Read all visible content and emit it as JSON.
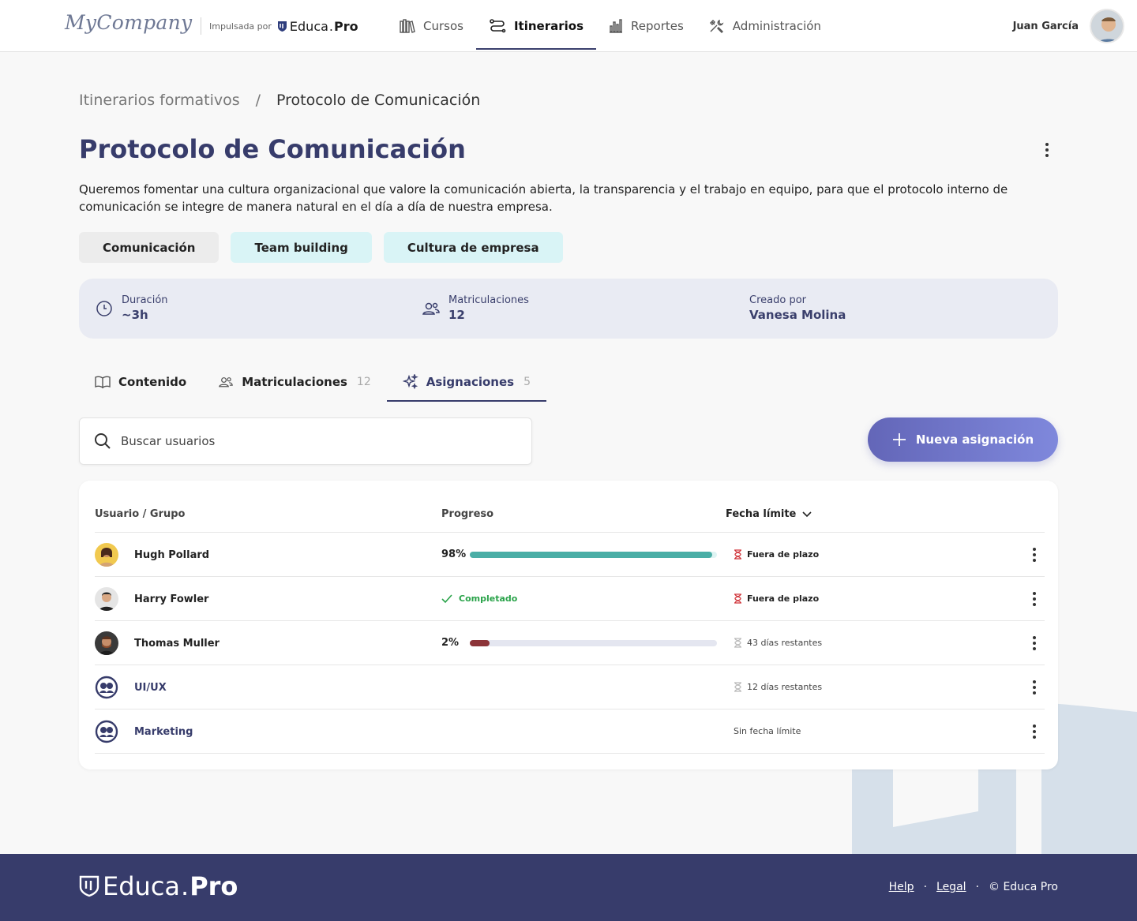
{
  "header": {
    "brand": "MyCompany",
    "powered_by": "Impulsada por",
    "educa_logo_text": "Educa",
    "educa_logo_bold": "Pro",
    "nav": [
      {
        "label": "Cursos",
        "icon": "books-icon",
        "active": false
      },
      {
        "label": "Itinerarios",
        "icon": "route-icon",
        "active": true
      },
      {
        "label": "Reportes",
        "icon": "bar-chart-icon",
        "active": false
      },
      {
        "label": "Administración",
        "icon": "tools-icon",
        "active": false
      }
    ],
    "user_name": "Juan García"
  },
  "breadcrumb": {
    "parent": "Itinerarios formativos",
    "separator": "/",
    "current": "Protocolo de Comunicación"
  },
  "page": {
    "title": "Protocolo de Comunicación",
    "description": "Queremos fomentar una cultura organizacional que valore la comunicación abierta, la transparencia y el trabajo en equipo, para que el protocolo interno de comunicación se integre de manera natural en el día a día de nuestra empresa.",
    "tags": [
      "Comunicación",
      "Team building",
      "Cultura de empresa"
    ]
  },
  "stats": {
    "duration_label": "Duración",
    "duration_value": "~3h",
    "enrollments_label": "Matriculaciones",
    "enrollments_value": "12",
    "created_label": "Creado por",
    "created_value": "Vanesa Molina"
  },
  "tabs": [
    {
      "label": "Contenido",
      "count": "",
      "icon": "book-icon"
    },
    {
      "label": "Matriculaciones",
      "count": "12",
      "icon": "users-icon"
    },
    {
      "label": "Asignaciones",
      "count": "5",
      "icon": "sparkles-icon",
      "active": true
    }
  ],
  "search": {
    "placeholder": "Buscar usuarios"
  },
  "new_button": {
    "label": "Nueva asignación"
  },
  "table": {
    "col_user": "Usuario / Grupo",
    "col_progress": "Progreso",
    "col_deadline": "Fecha límite",
    "rows": [
      {
        "name": "Hugh Pollard",
        "type": "user",
        "progress_label": "98%",
        "progress": 0.98,
        "progress_color": "#4aaea6",
        "track_color": "#def4f3",
        "deadline": "Fuera de plazo",
        "late": true
      },
      {
        "name": "Harry Fowler",
        "type": "user",
        "completed": "Completado",
        "deadline": "Fuera de plazo",
        "late": true
      },
      {
        "name": "Thomas Muller",
        "type": "user",
        "progress_label": "2%",
        "progress": 0.02,
        "progress_color": "#8c3438",
        "track_color": "#e4e6f0",
        "deadline": "43 días restantes",
        "late": false
      },
      {
        "name": "UI/UX",
        "type": "group",
        "deadline": "12 días restantes",
        "late": false
      },
      {
        "name": "Marketing",
        "type": "group",
        "deadline": "Sin fecha límite",
        "late": false
      }
    ]
  },
  "footer": {
    "logo_text": "Educa",
    "logo_bold": "Pro",
    "help": "Help",
    "legal": "Legal",
    "sep": "·",
    "copyright": "© Educa Pro"
  },
  "colors": {
    "primary": "#373c6b",
    "accent_button": "#6e74c9",
    "tag_teal": "#d9f4f6",
    "success": "#2aa34a",
    "danger": "#d0343a"
  }
}
